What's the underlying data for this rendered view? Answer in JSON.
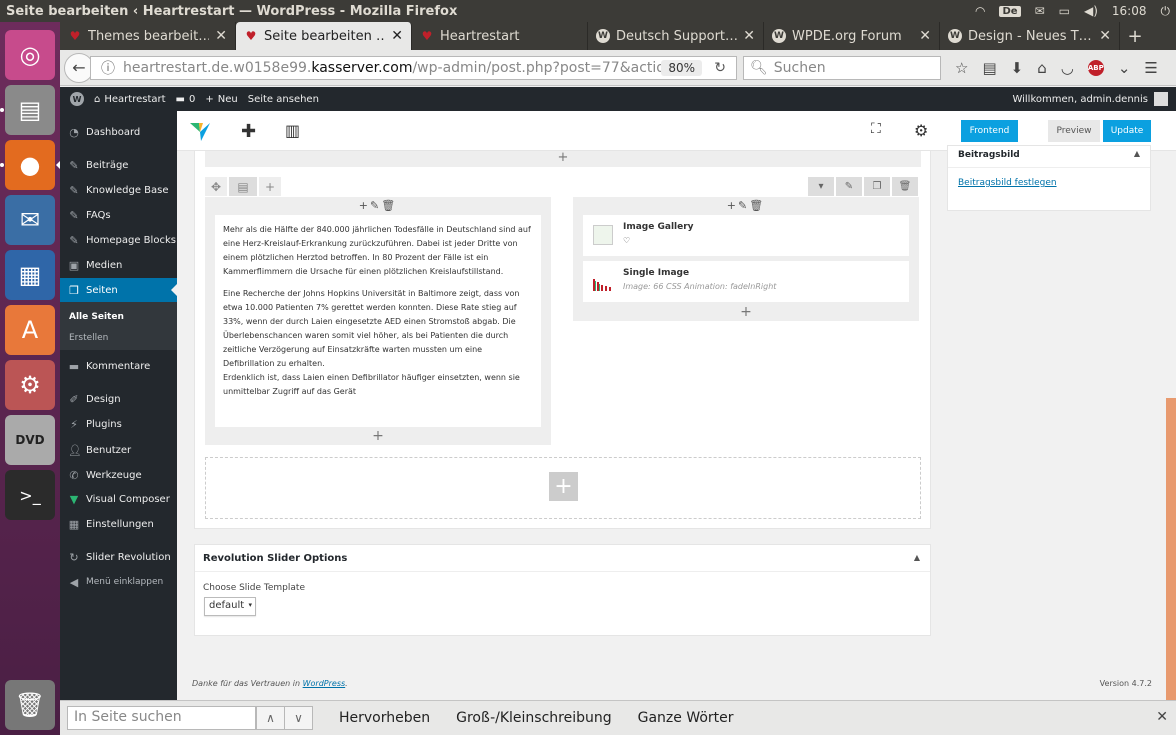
{
  "window": {
    "title": "Seite bearbeiten ‹ Heartrestart — WordPress - Mozilla Firefox",
    "kbd_layout": "De",
    "clock": "16:08"
  },
  "tabs": [
    {
      "label": "Themes bearbeit…",
      "icon": "heart-icon",
      "active": false
    },
    {
      "label": "Seite bearbeiten …",
      "icon": "heart-icon",
      "active": true
    },
    {
      "label": "Heartrestart",
      "icon": "heart-icon",
      "active": false
    },
    {
      "label": "Deutsch Support…",
      "icon": "wordpress-icon",
      "active": false
    },
    {
      "label": "WPDE.org Forum",
      "icon": "wordpress-icon",
      "active": false
    },
    {
      "label": "Design - Neues T…",
      "icon": "wordpress-icon",
      "active": false
    }
  ],
  "address": {
    "url_prefix": "heartrestart.de.w0158e99.",
    "url_domain": "kasserver.com",
    "url_suffix": "/wp-admin/post.php?post=77&action",
    "zoom": "80%",
    "search_placeholder": "Suchen"
  },
  "adminbar": {
    "site": "Heartrestart",
    "comments": "0",
    "new": "Neu",
    "view": "Seite ansehen",
    "welcome": "Willkommen, admin.dennis"
  },
  "menu": {
    "items": [
      {
        "label": "Dashboard",
        "icon": "dashboard-icon"
      },
      {
        "label": "Beiträge",
        "icon": "pin-icon"
      },
      {
        "label": "Knowledge Base",
        "icon": "pin-icon"
      },
      {
        "label": "FAQs",
        "icon": "pin-icon"
      },
      {
        "label": "Homepage Blocks",
        "icon": "pin-icon"
      },
      {
        "label": "Medien",
        "icon": "media-icon"
      },
      {
        "label": "Seiten",
        "icon": "pages-icon"
      },
      {
        "label": "Kommentare",
        "icon": "comment-icon"
      },
      {
        "label": "Design",
        "icon": "brush-icon"
      },
      {
        "label": "Plugins",
        "icon": "plugin-icon"
      },
      {
        "label": "Benutzer",
        "icon": "user-icon"
      },
      {
        "label": "Werkzeuge",
        "icon": "wrench-icon"
      },
      {
        "label": "Visual Composer",
        "icon": "vc-icon"
      },
      {
        "label": "Einstellungen",
        "icon": "settings-icon"
      },
      {
        "label": "Slider Revolution",
        "icon": "refresh-icon"
      },
      {
        "label": "Menü einklappen",
        "icon": "collapse-icon"
      }
    ],
    "sub_all": "Alle Seiten",
    "sub_new": "Erstellen"
  },
  "vc": {
    "frontend": "Frontend",
    "preview": "Preview",
    "update": "Update"
  },
  "text_block": {
    "p1": "Mehr als die Hälfte der 840.000 jährlichen Todesfälle in Deutschland sind auf eine Herz-Kreislauf-Erkrankung zurückzuführen. Dabei ist jeder Dritte von einem plötzlichen Herztod betroffen. In 80 Prozent der Fälle ist ein Kammerflimmern die Ursache für einen plötzlichen Kreislaufstillstand.",
    "p2": "Eine Recherche der Johns Hopkins Universität in Baltimore zeigt, dass von etwa 10.000 Patienten 7% gerettet werden konnten. Diese Rate stieg auf 33%, wenn der durch Laien eingesetzte AED einen Stromstoß abgab. Die Überlebenschancen waren somit viel höher, als bei Patienten die durch zeitliche Verzögerung auf Einsatzkräfte warten mussten um eine Defibrillation zu erhalten.",
    "p3": "Erdenklich ist, dass Laien einen Defibrillator häufiger einsetzten, wenn sie unmittelbar Zugriff auf das Gerät"
  },
  "elements": {
    "gallery_name": "Image Gallery",
    "single_name": "Single Image",
    "single_desc": "Image: 66  CSS Animation: fadeInRight"
  },
  "featured": {
    "title": "Beitragsbild",
    "link": "Beitragsbild festlegen"
  },
  "revslider": {
    "title": "Revolution Slider Options",
    "label": "Choose Slide Template",
    "value": "default"
  },
  "footer": {
    "thanks": "Danke für das Vertrauen in ",
    "link": "WordPress",
    "dot": ".",
    "version": "Version 4.7.2"
  },
  "findbar": {
    "placeholder": "In Seite suchen",
    "highlight": "Hervorheben",
    "case": "Groß-/Kleinschreibung",
    "words": "Ganze Wörter"
  },
  "colors": {
    "wp_blue": "#0073aa",
    "vc_blue": "#0ba0e0",
    "admin_dark": "#23282d",
    "launcher": "#5e2750"
  }
}
